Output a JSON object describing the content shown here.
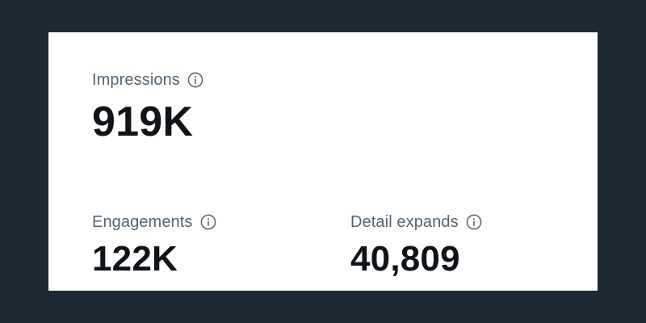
{
  "metrics": {
    "impressions": {
      "label": "Impressions",
      "value": "919K"
    },
    "engagements": {
      "label": "Engagements",
      "value": "122K"
    },
    "detail_expands": {
      "label": "Detail expands",
      "value": "40,809"
    }
  },
  "icons": {
    "info": "info-circle-icon"
  },
  "colors": {
    "background": "#1b2a35",
    "card": "#ffffff",
    "label": "#536471",
    "value": "#0f1419"
  }
}
